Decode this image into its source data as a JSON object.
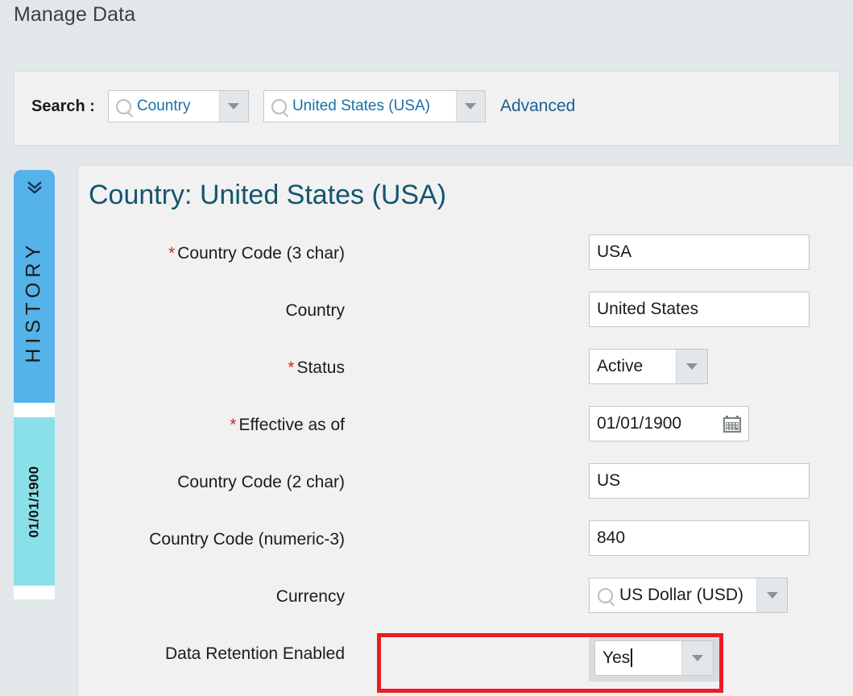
{
  "app": {
    "page_title": "Manage Data"
  },
  "search": {
    "label": "Search :",
    "category_value": "Country",
    "category_icon": "search-icon",
    "record_value": "United States (USA)",
    "record_icon": "search-icon",
    "advanced_link": "Advanced"
  },
  "history": {
    "tab_label": "HISTORY",
    "collapse_icon": "double-chevron-down-icon",
    "entries": [
      {
        "date": "01/01/1900"
      }
    ]
  },
  "record": {
    "title": "Country: United States (USA)"
  },
  "form": {
    "fields": [
      {
        "label": "Country Code (3 char)",
        "required": true,
        "type": "text",
        "value": "USA"
      },
      {
        "label": "Country",
        "required": false,
        "type": "text",
        "value": "United States",
        "trailing_icon": "globe-icon"
      },
      {
        "label": "Status",
        "required": true,
        "type": "select",
        "value": "Active"
      },
      {
        "label": "Effective as of",
        "required": true,
        "type": "date",
        "value": "01/01/1900",
        "trailing_icon": "calendar-icon"
      },
      {
        "label": "Country Code (2 char)",
        "required": false,
        "type": "text",
        "value": "US"
      },
      {
        "label": "Country Code (numeric-3)",
        "required": false,
        "type": "text",
        "value": "840"
      },
      {
        "label": "Currency",
        "required": false,
        "type": "lookup",
        "value": "US Dollar (USD)",
        "leading_icon": "search-icon",
        "trailing_icon": "prompt-card-icon"
      },
      {
        "label": "Data Retention Enabled",
        "required": false,
        "type": "select",
        "value": "Yes",
        "focused": true,
        "highlighted": true
      }
    ]
  },
  "colors": {
    "page_background": "#e2e7ea",
    "panel_background": "#f1f1f1",
    "record_title": "#14566f",
    "link": "#1b5e8f",
    "search_text": "#1a6fa8",
    "required_marker": "#cf2727",
    "history_tab": "#54b3e8",
    "history_entry": "#8ae0e8",
    "annotation_box": "#ec1c24",
    "input_border": "#c0c8cc"
  }
}
